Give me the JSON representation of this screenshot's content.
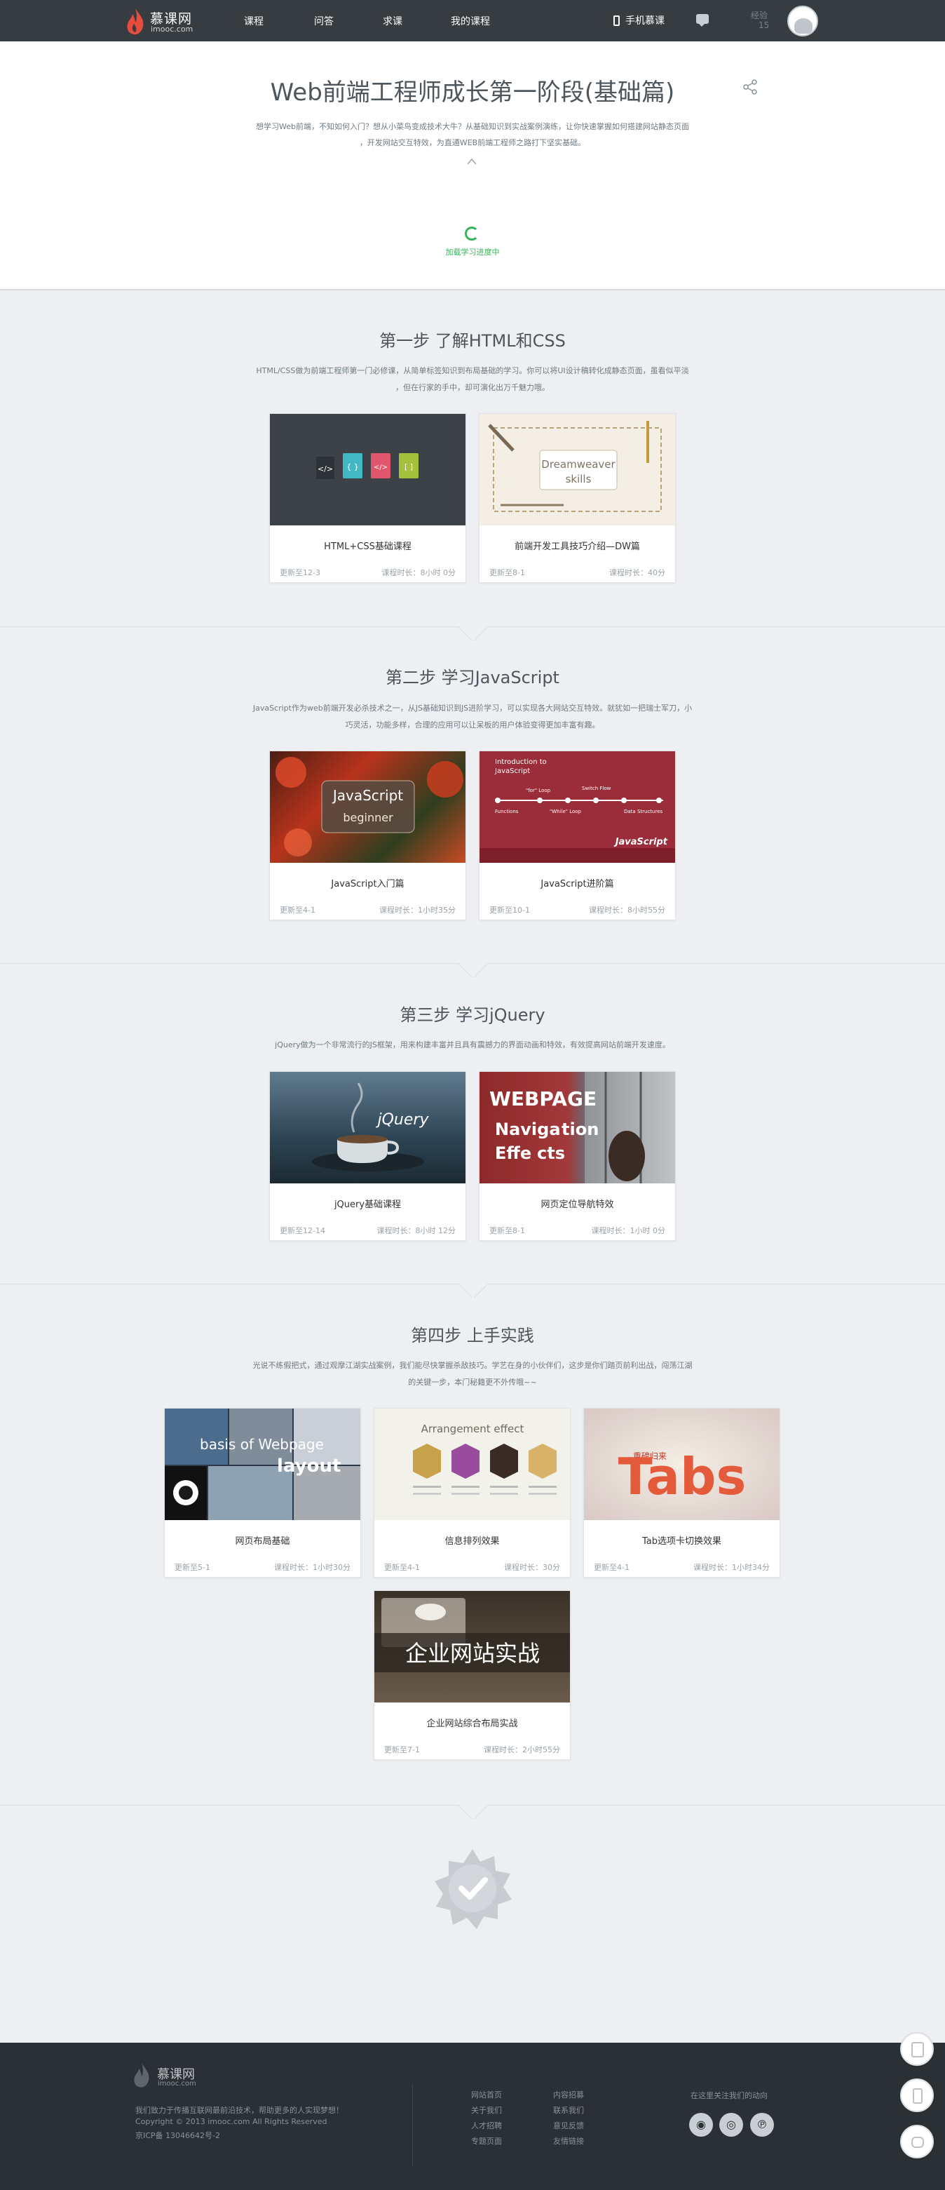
{
  "header": {
    "logo_text": "慕课网",
    "logo_domain": "imooc.com",
    "nav": [
      "课程",
      "问答",
      "求课",
      "我的课程"
    ],
    "mobile_label": "手机慕课",
    "level_label": "经验",
    "level_value": "15"
  },
  "hero": {
    "title": "Web前端工程师成长第一阶段(基础篇)",
    "desc_line1": "想学习Web前端，不知如何入门？想从小菜鸟变成技术大牛？从基础知识到实战案例演练，让你快速掌握如何搭建网站静态页面",
    "desc_line2": "，开发网站交互特效，为直通WEB前端工程师之路打下坚实基础。",
    "loading_text": "加载学习进度中"
  },
  "steps": [
    {
      "title": "第一步 了解HTML和CSS",
      "desc": [
        "HTML/CSS做为前端工程师第一门必修课，从简单标签知识到布局基础的学习。你可以将UI设计稿转化成静态页面，虽看似平淡",
        "，但在行家的手中，却可演化出万千魅力哦。"
      ],
      "courses": [
        {
          "title": "HTML+CSS基础课程",
          "updated": "更新至12-3",
          "duration": "课程时长：8小时 0分"
        },
        {
          "title": "前端开发工具技巧介绍—DW篇",
          "updated": "更新至8-1",
          "duration": "课程时长：40分"
        }
      ]
    },
    {
      "title": "第二步 学习JavaScript",
      "desc": [
        "JavaScript作为web前端开发必杀技术之一，从JS基础知识到JS进阶学习，可以实现各大网站交互特效。就犹如一把瑞士军刀，小",
        "巧灵活，功能多样，合理的应用可以让呆板的用户体验变得更加丰富有趣。"
      ],
      "courses": [
        {
          "title": "JavaScript入门篇",
          "updated": "更新至4-1",
          "duration": "课程时长：1小时35分"
        },
        {
          "title": "JavaScript进阶篇",
          "updated": "更新至10-1",
          "duration": "课程时长：8小时55分"
        }
      ]
    },
    {
      "title": "第三步 学习jQuery",
      "desc": [
        "jQuery做为一个非常流行的JS框架，用来构建丰富并且具有震撼力的界面动画和特效，有效提高网站前端开发速度。"
      ],
      "courses": [
        {
          "title": "jQuery基础课程",
          "updated": "更新至12-14",
          "duration": "课程时长：8小时 12分"
        },
        {
          "title": "网页定位导航特效",
          "updated": "更新至8-1",
          "duration": "课程时长：1小时 0分"
        }
      ]
    },
    {
      "title": "第四步 上手实践",
      "desc": [
        "光说不练假把式，通过观摩江湖实战案例，我们能尽快掌握杀敌技巧。学艺在身的小伙伴们，这步是你们踏页前利出战，闯荡江湖",
        "的关键一步，本门秘籍更不外传哦~~"
      ],
      "courses": [
        {
          "title": "网页布局基础",
          "updated": "更新至5-1",
          "duration": "课程时长：1小时30分"
        },
        {
          "title": "信息排列效果",
          "updated": "更新至4-1",
          "duration": "课程时长：30分"
        },
        {
          "title": "Tab选项卡切换效果",
          "updated": "更新至4-1",
          "duration": "课程时长：1小时34分"
        },
        {
          "title": "企业网站综合布局实战",
          "updated": "更新至7-1",
          "duration": "课程时长：2小时55分"
        }
      ]
    }
  ],
  "thumb_text": {
    "dw": [
      "Dreamweaver",
      "skills"
    ],
    "js_intro": [
      "JavaScript",
      "beginner"
    ],
    "js_adv": [
      "Introduction to",
      "JavaScript",
      "\"for\" Loop",
      "Switch Flow",
      "\"While\" Loop",
      "Data Structures",
      "Functions"
    ],
    "jq": "jQuery",
    "nav": [
      "WEBPAGE",
      "Naviga",
      "tion",
      "Effe",
      "cts"
    ],
    "layout": [
      "basis of  Webpage",
      "layout"
    ],
    "arrange": "Arrangement  effect",
    "tabs": [
      "Tabs",
      "重磅归来"
    ],
    "enterprise": "企业网站实战"
  },
  "footer": {
    "logo_text": "慕课网",
    "logo_domain": "imooc.com",
    "slogan": "我们致力于传播互联网最前沿技术，帮助更多的人实现梦想！",
    "copyright": "Copyright © 2013 imooc.com All Rights Reserved",
    "icp": "京ICP备 13046642号-2",
    "links_col1": [
      "网站首页",
      "关于我们",
      "人才招聘",
      "专题页面"
    ],
    "links_col2": [
      "内容招募",
      "联系我们",
      "意见反馈",
      "友情链接"
    ],
    "follow": "在这里关注我们的动向"
  },
  "colors": {
    "topbar": "#363c40",
    "accent": "#35b558",
    "footer": "#2b3034",
    "background": "#edeff2"
  }
}
